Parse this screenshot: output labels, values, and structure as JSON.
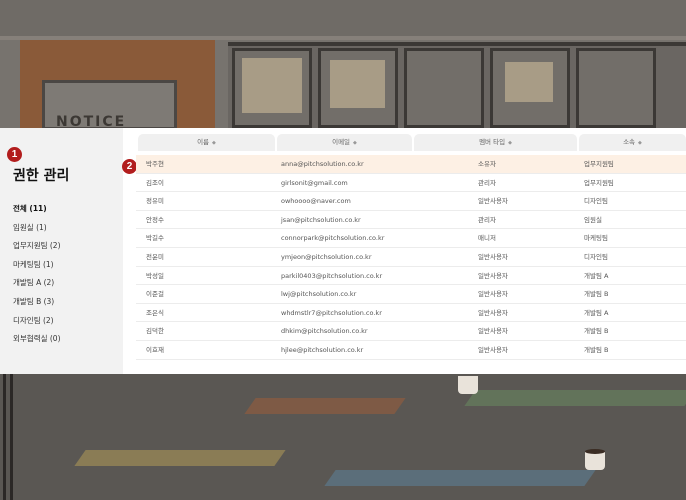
{
  "background": {
    "notice_text": "NOTICE"
  },
  "badges": {
    "step1": "1",
    "step2": "2"
  },
  "panel": {
    "title": "권한 관리"
  },
  "nav": [
    {
      "label": "전체 (11)",
      "active": true
    },
    {
      "label": "임원실 (1)"
    },
    {
      "label": "업무지원팀 (2)"
    },
    {
      "label": "마케팅팀 (1)"
    },
    {
      "label": "개발팀 A (2)"
    },
    {
      "label": "개발팀 B (3)"
    },
    {
      "label": "디자인팀 (2)"
    },
    {
      "label": "외부협력실 (0)"
    }
  ],
  "columns": {
    "name": "이름",
    "email": "이메일",
    "type": "멤버 타입",
    "dept": "소속",
    "sort_icon": "◆"
  },
  "rows": [
    {
      "name": "박주현",
      "email": "anna@pitchsolution.co.kr",
      "type": "소유자",
      "dept": "업무지원팀",
      "selected": true
    },
    {
      "name": "김조이",
      "email": "girlsonit@gmail.com",
      "type": "관리자",
      "dept": "업무지원팀"
    },
    {
      "name": "정유미",
      "email": "owhoooo@naver.com",
      "type": "일반사용자",
      "dept": "디자인팀"
    },
    {
      "name": "안정수",
      "email": "jsan@pitchsolution.co.kr",
      "type": "관리자",
      "dept": "임원실"
    },
    {
      "name": "박길수",
      "email": "connorpark@pitchsolution.co.kr",
      "type": "매니저",
      "dept": "마케팅팀"
    },
    {
      "name": "전윤미",
      "email": "ymjeon@pitchsolution.co.kr",
      "type": "일반사용자",
      "dept": "디자인팀"
    },
    {
      "name": "박성일",
      "email": "parkil0403@pitchsolution.co.kr",
      "type": "일반사용자",
      "dept": "개발팀 A"
    },
    {
      "name": "이준걸",
      "email": "lwj@pitchsolution.co.kr",
      "type": "일반사용자",
      "dept": "개발팀 B"
    },
    {
      "name": "조은식",
      "email": "whdmstlr7@pitchsolution.co.kr",
      "type": "일반사용자",
      "dept": "개발팀 A"
    },
    {
      "name": "김덕한",
      "email": "dhkim@pitchsolution.co.kr",
      "type": "일반사용자",
      "dept": "개발팀 B"
    },
    {
      "name": "이효재",
      "email": "hjlee@pitchsolution.co.kr",
      "type": "일반사용자",
      "dept": "개발팀 B"
    }
  ],
  "colors": {
    "badge": "#b21d1d",
    "selected_row": "#fdf0e4",
    "sidebar_bg": "#f2f2f2"
  }
}
